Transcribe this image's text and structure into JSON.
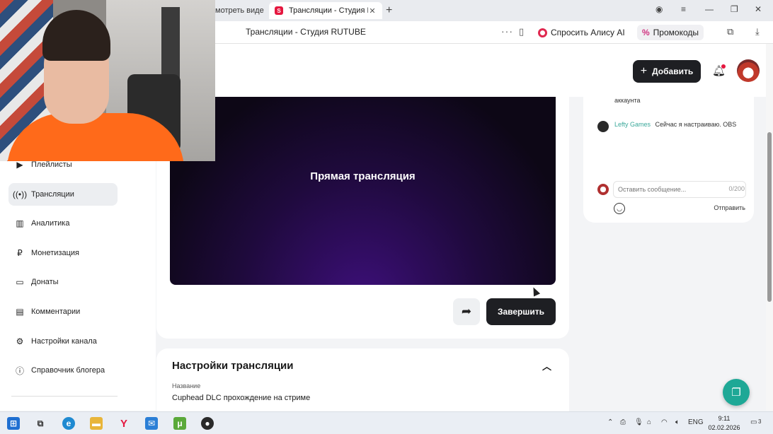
{
  "browser": {
    "prev_tab_label": "мотреть виде",
    "active_tab": {
      "title": "Трансляции - Студия R",
      "favicon": "S"
    },
    "page_title": "Трансляции - Студия RUTUBE",
    "alice_label": "Спросить Алису AI",
    "promo_label": "Промокоды",
    "promo_icon": "%"
  },
  "header": {
    "add_label": "Добавить"
  },
  "sidebar": {
    "items": [
      {
        "label": "Плейлисты",
        "icon": "playlist-icon"
      },
      {
        "label": "Трансляции",
        "icon": "broadcast-icon",
        "active": true
      },
      {
        "label": "Аналитика",
        "icon": "analytics-icon"
      },
      {
        "label": "Монетизация",
        "icon": "monetization-icon"
      },
      {
        "label": "Донаты",
        "icon": "donations-icon"
      },
      {
        "label": "Комментарии",
        "icon": "comments-icon"
      },
      {
        "label": "Настройки канала",
        "icon": "gear-icon"
      },
      {
        "label": "Справочник блогера",
        "icon": "info-icon"
      }
    ]
  },
  "player": {
    "label": "Прямая трансляция"
  },
  "actions": {
    "finish_label": "Завершить"
  },
  "settings": {
    "title": "Настройки трансляции",
    "name_label": "Название",
    "name_value": "Cuphead DLC прохождение на стриме"
  },
  "chat": {
    "prev_fragment": "аккаунта",
    "message": {
      "author": "Lefty Games",
      "text": "Сейчас я настраиваю. OBS"
    },
    "input_placeholder": "Оставить сообщение...",
    "counter": "0/200",
    "send_label": "Отправить"
  },
  "taskbar": {
    "lang": "ENG",
    "time": "9:11",
    "date": "02.02.2026",
    "notification_count": "3"
  },
  "colors": {
    "accent_dark": "#1e1f23",
    "brand_red": "#e5173f",
    "chat_author": "#3aa89a",
    "help_button": "#1ea896"
  }
}
